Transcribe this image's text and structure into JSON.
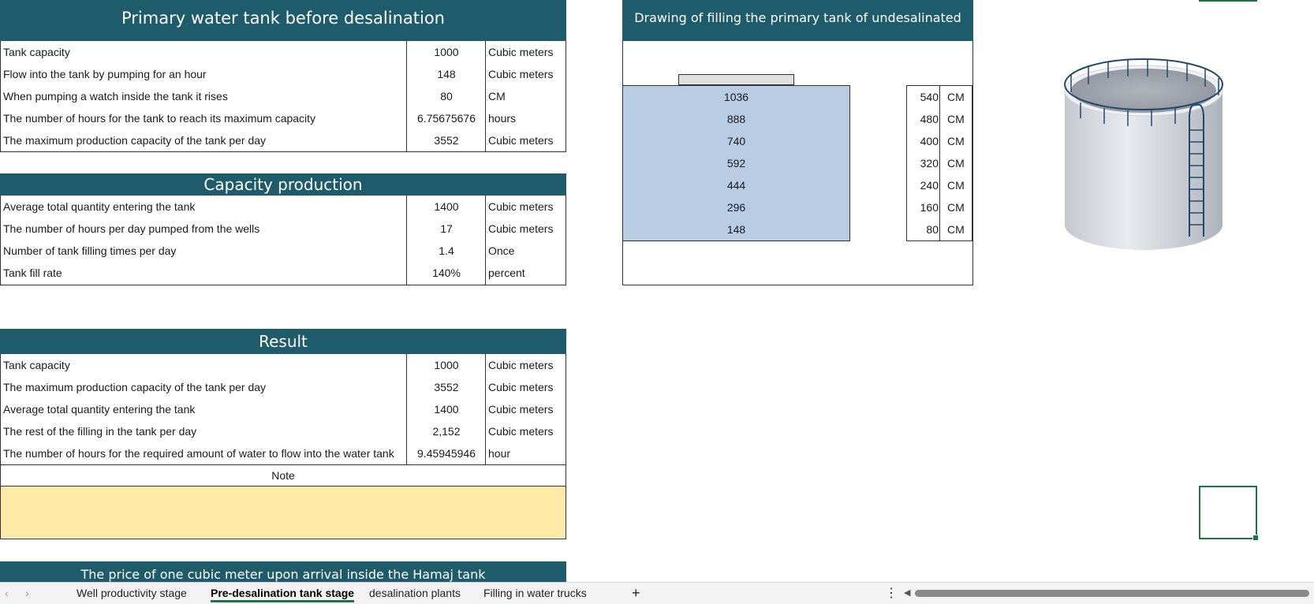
{
  "primary": {
    "title": "Primary water tank before desalination",
    "rows": [
      {
        "label": "Tank capacity",
        "value": "1000",
        "unit": "Cubic meters"
      },
      {
        "label": "Flow into the tank by pumping for an hour",
        "value": "148",
        "unit": "Cubic meters"
      },
      {
        "label": "When pumping a watch inside the tank it rises",
        "value": "80",
        "unit": "CM"
      },
      {
        "label": "The number of hours for the tank to reach its maximum capacity",
        "value": "6.75675676",
        "unit": "hours"
      },
      {
        "label": "The maximum production capacity of the tank per day",
        "value": "3552",
        "unit": "Cubic meters"
      }
    ]
  },
  "capacity": {
    "title": "Capacity production",
    "rows": [
      {
        "label": "Average total quantity entering the tank",
        "value": "1400",
        "unit": "Cubic meters"
      },
      {
        "label": "The number of hours per day pumped from the wells",
        "value": "17",
        "unit": "Cubic meters"
      },
      {
        "label": "Number of tank filling times per day",
        "value": "1.4",
        "unit": "Once"
      },
      {
        "label": "Tank fill rate",
        "value": "140%",
        "unit": "percent"
      }
    ]
  },
  "result": {
    "title": "Result",
    "rows": [
      {
        "label": "Tank capacity",
        "value": "1000",
        "unit": "Cubic meters"
      },
      {
        "label": "The maximum production capacity of the tank per day",
        "value": "3552",
        "unit": "Cubic meters"
      },
      {
        "label": "Average total quantity entering the tank",
        "value": "1400",
        "unit": "Cubic meters"
      },
      {
        "label": "The rest of the filling in the tank per day",
        "value": "2,152",
        "unit": "Cubic meters"
      },
      {
        "label": "The number of hours for the required amount of water to flow into the water tank",
        "value": "9.45945946",
        "unit": "hour"
      }
    ],
    "note_label": "Note"
  },
  "price_title": "The price of one cubic meter upon arrival inside the Hamaj tank",
  "drawing": {
    "title": "Drawing of filling the primary tank of undesalinated water",
    "levels": [
      "1036",
      "888",
      "740",
      "592",
      "444",
      "296",
      "148"
    ],
    "scale": [
      {
        "value": "540",
        "unit": "CM"
      },
      {
        "value": "480",
        "unit": "CM"
      },
      {
        "value": "400",
        "unit": "CM"
      },
      {
        "value": "320",
        "unit": "CM"
      },
      {
        "value": "240",
        "unit": "CM"
      },
      {
        "value": "160",
        "unit": "CM"
      },
      {
        "value": "80",
        "unit": "CM"
      }
    ]
  },
  "tabs": {
    "items": [
      "Well productivity stage",
      "Pre-desalination tank stage",
      "desalination plants",
      "Filling in water trucks"
    ],
    "active": "Pre-desalination tank stage",
    "add": "+"
  },
  "colors": {
    "header": "#1f5c6b",
    "water_fill": "#b8cce4",
    "note_fill": "#ffeaa7",
    "active_tab": "#217346"
  }
}
